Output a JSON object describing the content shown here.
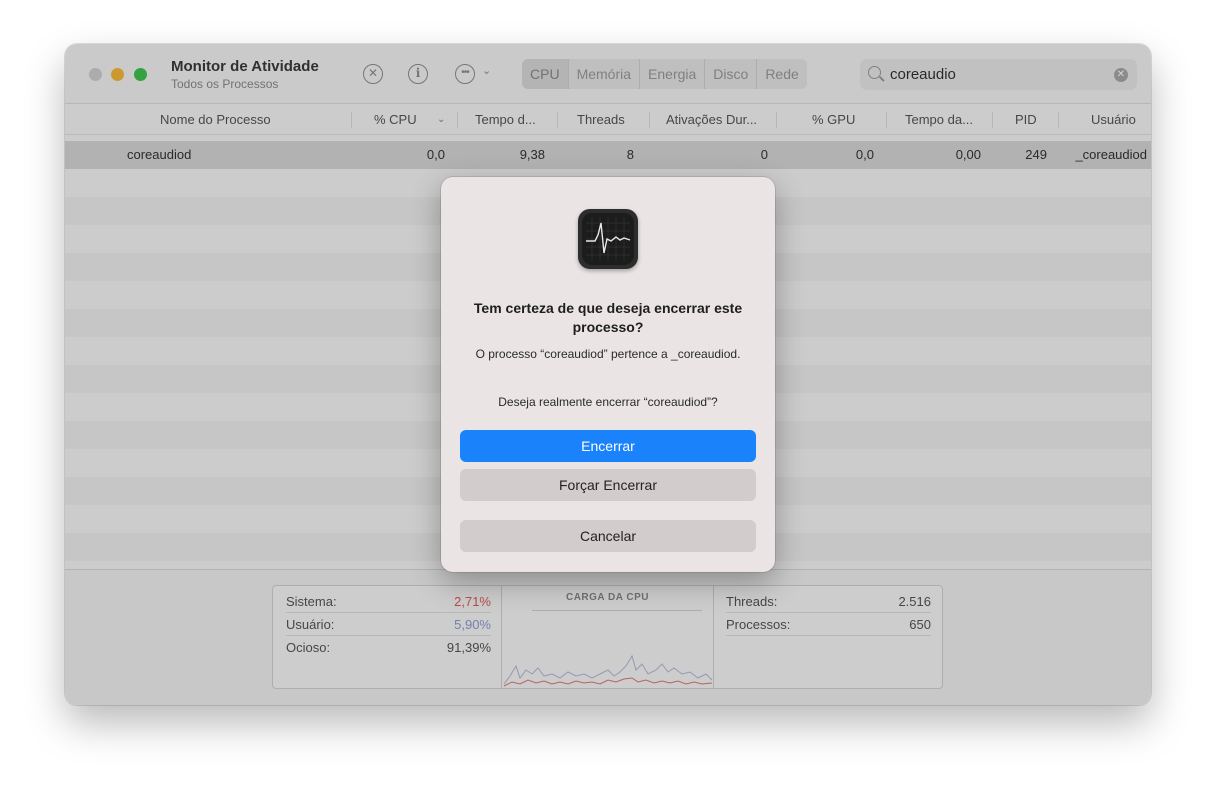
{
  "window": {
    "title": "Monitor de Atividade",
    "subtitle": "Todos os Processos"
  },
  "toolbar": {
    "stop_icon": "x-circle-icon",
    "info_icon": "info-icon",
    "more_icon": "ellipsis-circle-icon",
    "tabs": [
      "CPU",
      "Memória",
      "Energia",
      "Disco",
      "Rede"
    ],
    "active_tab": "CPU"
  },
  "search": {
    "value": "coreaudio"
  },
  "table": {
    "columns": [
      "Nome do Processo",
      "% CPU",
      "Tempo d...",
      "Threads",
      "Ativações Dur...",
      "% GPU",
      "Tempo da...",
      "PID",
      "Usuário"
    ],
    "rows": [
      {
        "name": "coreaudiod",
        "cpu": "0,0",
        "time": "9,38",
        "threads": "8",
        "wakeups": "0",
        "gpu": "0,0",
        "gpu_time": "0,00",
        "pid": "249",
        "user": "_coreaudiod"
      }
    ]
  },
  "stats": {
    "sistema_label": "Sistema:",
    "sistema_value": "2,71%",
    "usuario_label": "Usuário:",
    "usuario_value": "5,90%",
    "ocioso_label": "Ocioso:",
    "ocioso_value": "91,39%",
    "graph_title": "CARGA DA CPU",
    "threads_label": "Threads:",
    "threads_value": "2.516",
    "processos_label": "Processos:",
    "processos_value": "650"
  },
  "colors": {
    "accent": "#1a82fb",
    "sistema": "#e05a5a",
    "usuario": "#8c9bd0"
  },
  "dialog": {
    "title": "Tem certeza de que deseja encerrar este processo?",
    "message": "O processo “coreaudiod” pertence a _coreaudiod.",
    "question": "Deseja realmente encerrar “coreaudiod”?",
    "primary_button": "Encerrar",
    "force_button": "Forçar Encerrar",
    "cancel_button": "Cancelar",
    "icon": "activity-monitor-icon"
  }
}
